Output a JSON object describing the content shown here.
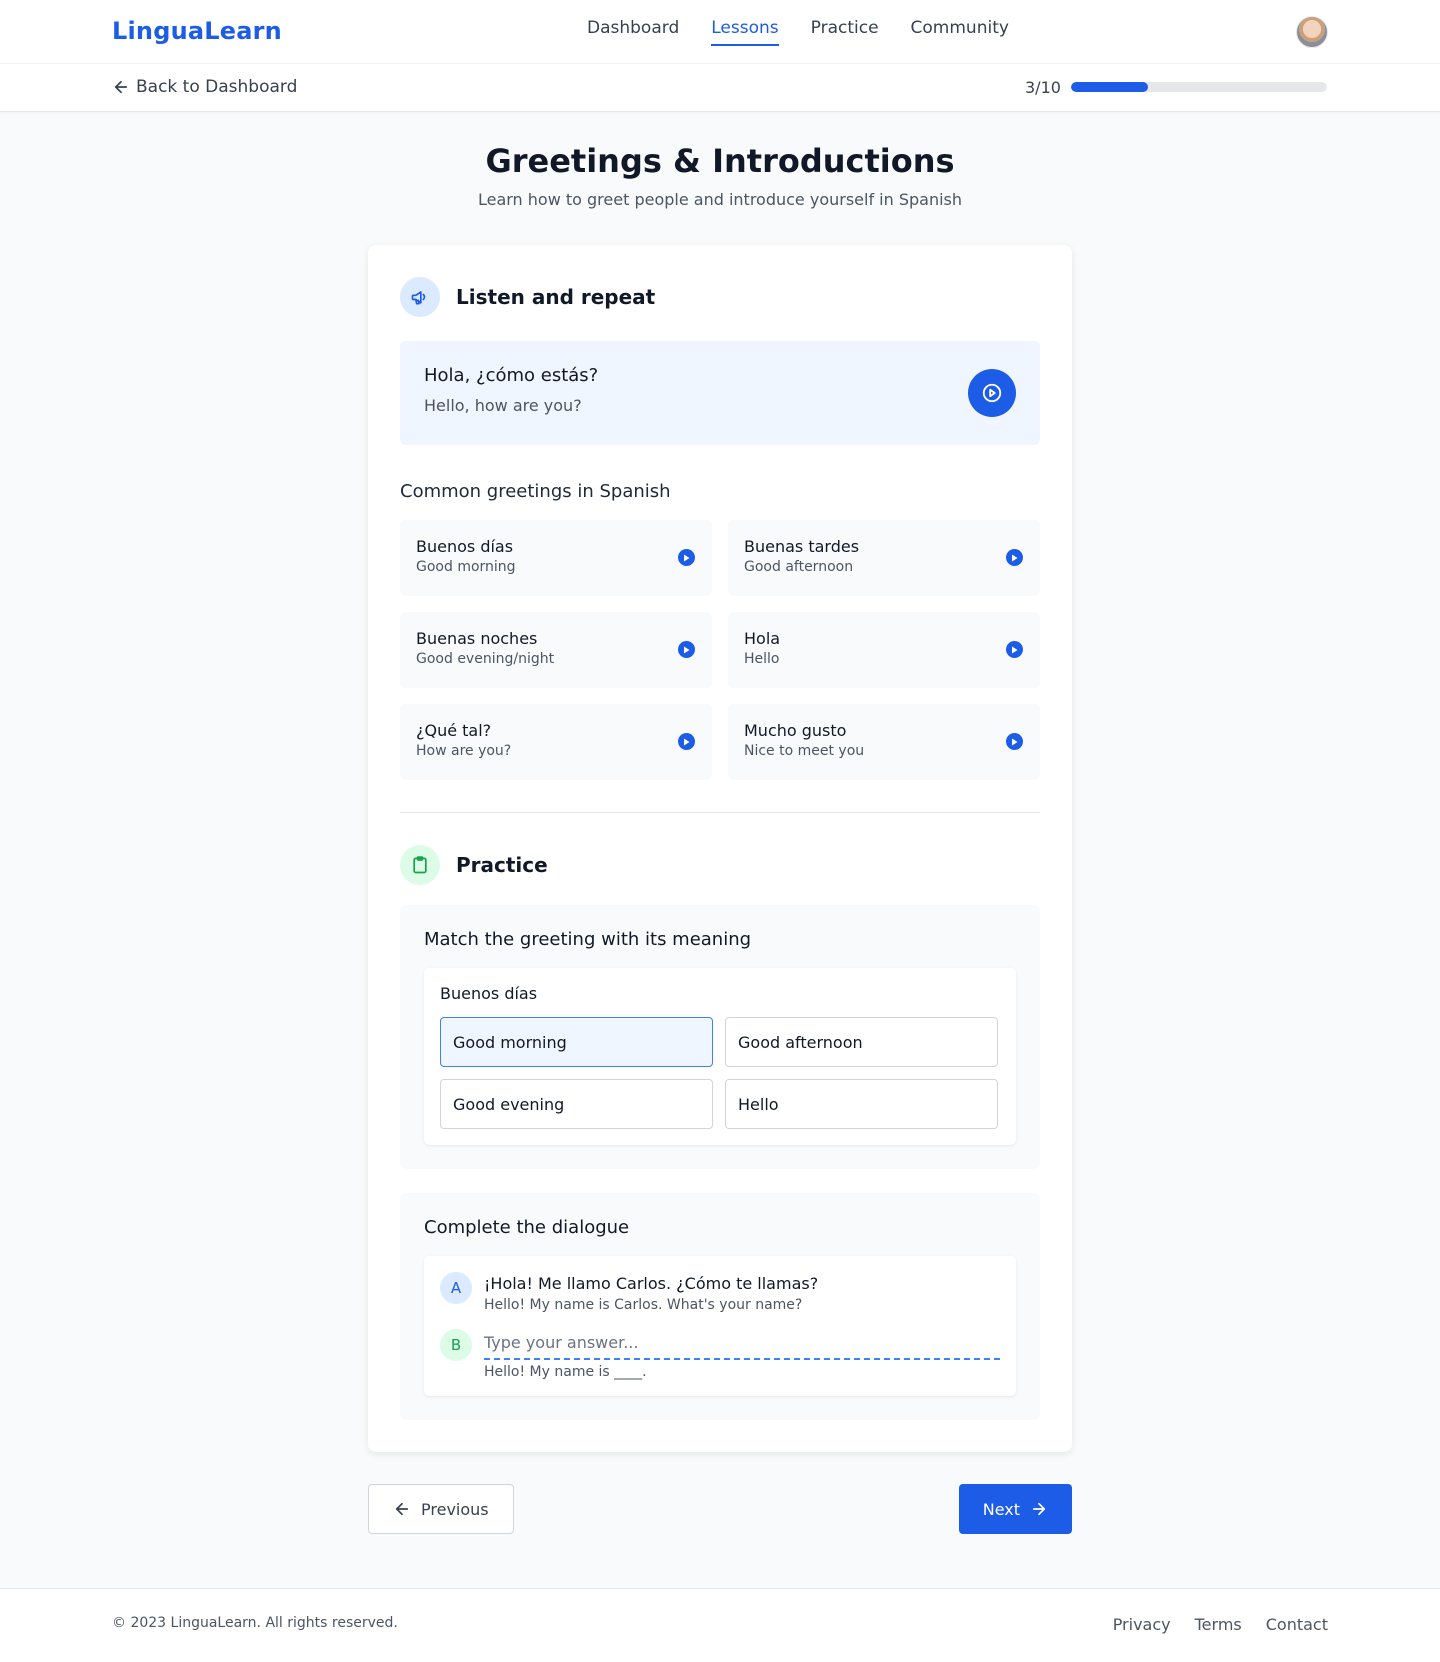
{
  "header": {
    "logo": "LinguaLearn",
    "nav": [
      "Dashboard",
      "Lessons",
      "Practice",
      "Community"
    ],
    "active_nav": "Lessons"
  },
  "subbar": {
    "back_label": "Back to Dashboard",
    "progress_text": "3/10",
    "progress_fraction": 0.3
  },
  "lesson": {
    "title": "Greetings & Introductions",
    "subtitle": "Learn how to greet people and introduce yourself in Spanish"
  },
  "listen": {
    "heading": "Listen and repeat",
    "phrase_es": "Hola, ¿cómo estás?",
    "phrase_en": "Hello, how are you?"
  },
  "greetings": {
    "heading": "Common greetings in Spanish",
    "items": [
      {
        "es": "Buenos días",
        "en": "Good morning"
      },
      {
        "es": "Buenas tardes",
        "en": "Good afternoon"
      },
      {
        "es": "Buenas noches",
        "en": "Good evening/night"
      },
      {
        "es": "Hola",
        "en": "Hello"
      },
      {
        "es": "¿Qué tal?",
        "en": "How are you?"
      },
      {
        "es": "Mucho gusto",
        "en": "Nice to meet you"
      }
    ]
  },
  "practice": {
    "heading": "Practice",
    "match": {
      "title": "Match the greeting with its meaning",
      "question": "Buenos días",
      "options": [
        "Good morning",
        "Good afternoon",
        "Good evening",
        "Hello"
      ],
      "selected": "Good morning"
    },
    "dialogue": {
      "title": "Complete the dialogue",
      "speaker_a": "A",
      "line_a_es": "¡Hola! Me llamo Carlos. ¿Cómo te llamas?",
      "line_a_en": "Hello! My name is Carlos. What's your name?",
      "speaker_b": "B",
      "answer_placeholder": "Type your answer...",
      "answer_value": "",
      "line_b_en": "Hello! My name is ____."
    }
  },
  "buttons": {
    "previous": "Previous",
    "next": "Next"
  },
  "footer": {
    "copyright": "© 2023 LinguaLearn. All rights reserved.",
    "links": [
      "Privacy",
      "Terms",
      "Contact"
    ]
  },
  "colors": {
    "accent": "#1d5ce6",
    "success": "#16a34a"
  }
}
